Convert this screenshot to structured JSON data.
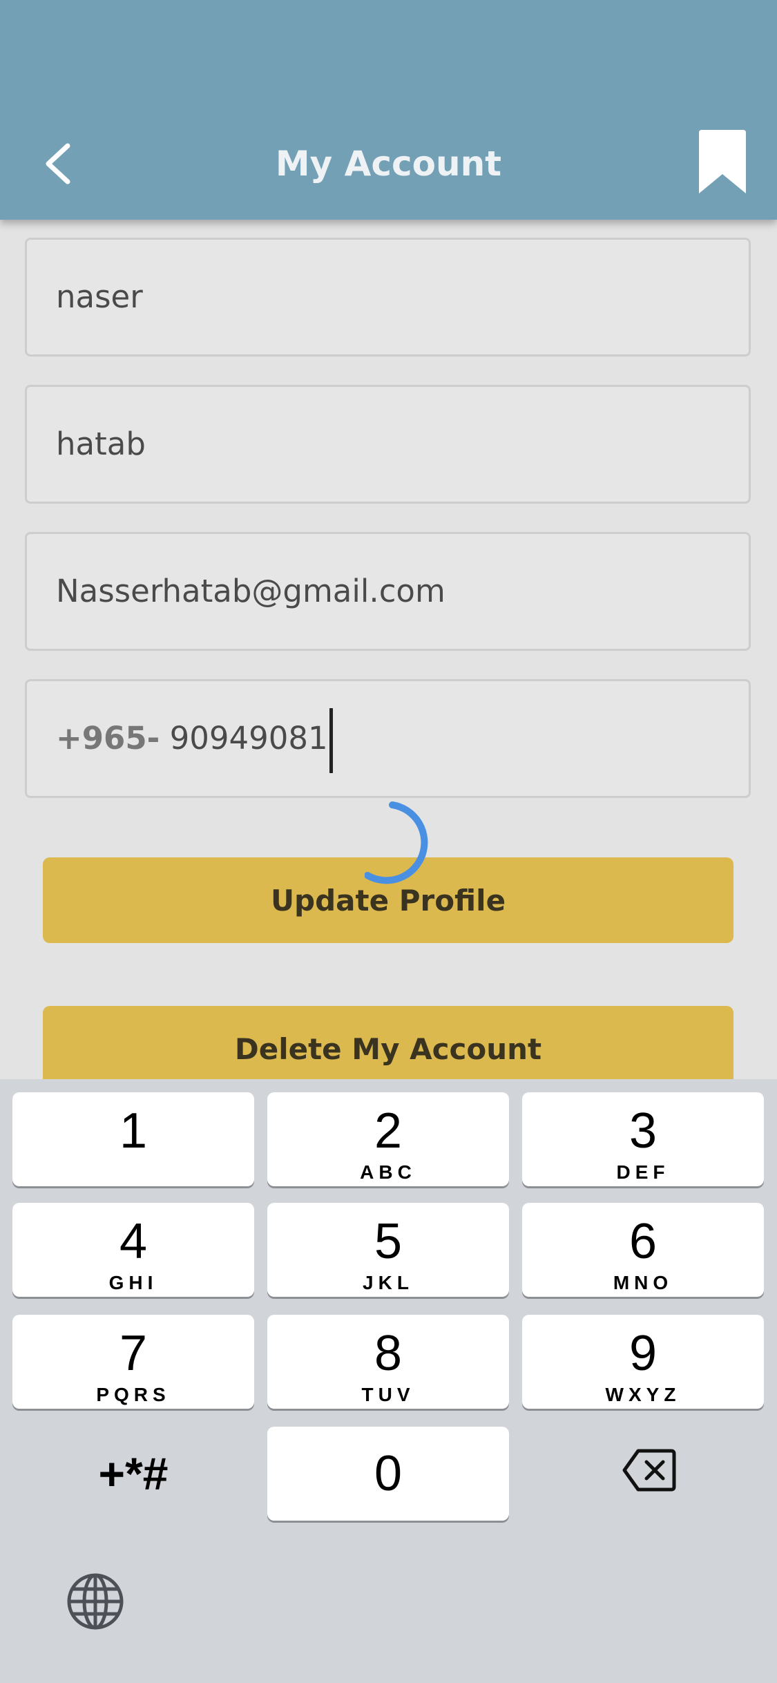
{
  "header": {
    "title": "My Account",
    "back_icon": "chevron-left-icon",
    "bookmark_icon": "bookmark-icon",
    "background_color": "#74a0b6"
  },
  "form": {
    "first_name": "naser",
    "last_name": "hatab",
    "email": "Nasserhatab@gmail.com",
    "phone_prefix": "+965-",
    "phone_number": "90949081"
  },
  "buttons": {
    "update_profile": "Update Profile",
    "delete_account": "Delete My Account",
    "color": "#dcb94e"
  },
  "spinner": {
    "icon": "loading-spinner-icon",
    "color": "#4a90e2"
  },
  "keyboard": {
    "keys": [
      {
        "num": "1",
        "letters": ""
      },
      {
        "num": "2",
        "letters": "ABC"
      },
      {
        "num": "3",
        "letters": "DEF"
      },
      {
        "num": "4",
        "letters": "GHI"
      },
      {
        "num": "5",
        "letters": "JKL"
      },
      {
        "num": "6",
        "letters": "MNO"
      },
      {
        "num": "7",
        "letters": "PQRS"
      },
      {
        "num": "8",
        "letters": "TUV"
      },
      {
        "num": "9",
        "letters": "WXYZ"
      },
      {
        "num": "0",
        "letters": ""
      }
    ],
    "symbols": "+*#",
    "delete_icon": "backspace-icon",
    "globe_icon": "globe-icon"
  }
}
